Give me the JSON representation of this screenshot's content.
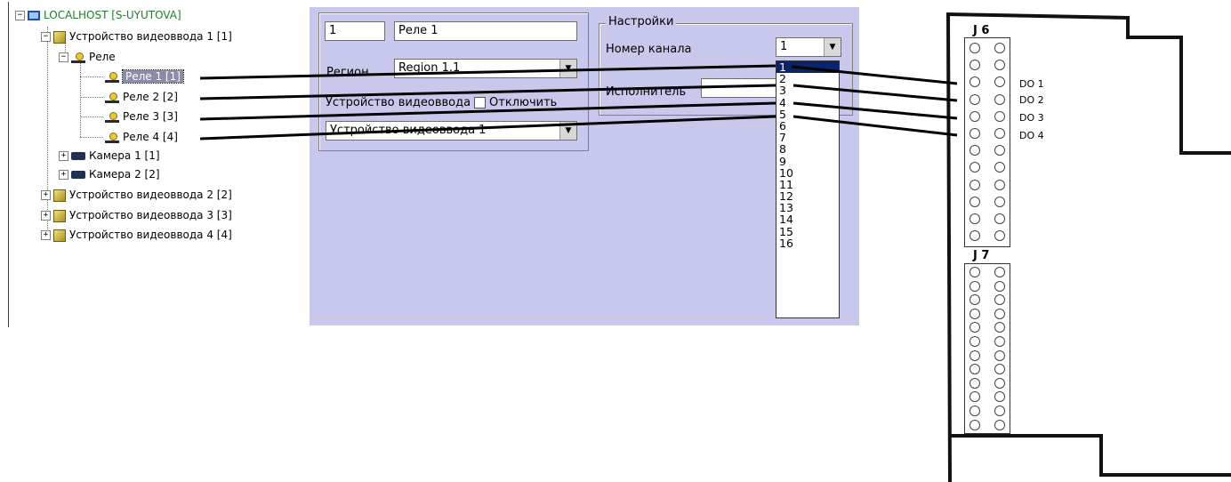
{
  "tree": {
    "host": "LOCALHOST [S-UYUTOVA]",
    "device1": "Устройство видеоввода 1 [1]",
    "relay_group": "Реле",
    "relays": [
      "Реле 1 [1]",
      "Реле 2 [2]",
      "Реле 3 [3]",
      "Реле 4 [4]"
    ],
    "cameras": [
      "Камера 1 [1]",
      "Камера 2 [2]"
    ],
    "devices": [
      "Устройство видеоввода 2 [2]",
      "Устройство видеоввода 3 [3]",
      "Устройство видеоввода 4 [4]"
    ]
  },
  "panel": {
    "id_value": "1",
    "name_value": "Реле 1",
    "region_label": "Регион",
    "region_value": "Region 1.1",
    "device_label": "Устройство видеоввода",
    "disable_label": "Отключить",
    "device_value": "Устройство видеоввода 1",
    "settings_legend": "Настройки",
    "channel_label": "Номер канала",
    "channel_value": "1",
    "executor_label": "Исполнитель",
    "channel_options": [
      "1",
      "2",
      "3",
      "4",
      "5",
      "6",
      "7",
      "8",
      "9",
      "10",
      "11",
      "12",
      "13",
      "14",
      "15",
      "16"
    ]
  },
  "board": {
    "j6": "J 6",
    "j7": "J 7",
    "outputs": [
      "DO 1",
      "DO 2",
      "DO 3",
      "DO 4"
    ]
  },
  "colors": {
    "panel_bg": "#c7c8ec",
    "host_text": "#1e7d2b",
    "selection": "#8a8ca8",
    "list_highlight": "#0a246a"
  }
}
